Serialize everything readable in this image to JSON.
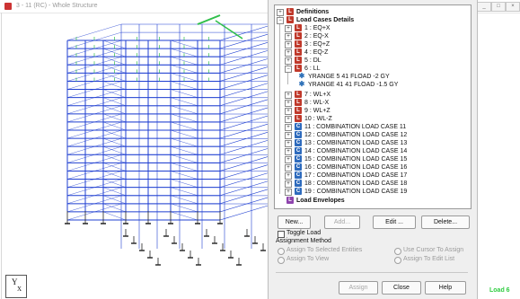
{
  "viewport": {
    "title": "3 - 11 (RC) - Whole Structure",
    "status_text": "Load 6",
    "axis_y_label": "Y",
    "axis_x_label": "X"
  },
  "dialog": {
    "tree": {
      "definitions_label": "Definitions",
      "load_cases_label": "Load Cases Details",
      "load_cases": [
        {
          "label": "1 : EQ+X"
        },
        {
          "label": "2 : EQ-X"
        },
        {
          "label": "3 : EQ+Z"
        },
        {
          "label": "4 : EQ-Z"
        },
        {
          "label": "5 : DL"
        },
        {
          "label": "6 : LL"
        }
      ],
      "ll_children": [
        {
          "label": "YRANGE 5 41 FLOAD -2 GY"
        },
        {
          "label": "YRANGE 41 41 FLOAD -1.5 GY"
        }
      ],
      "wind_cases": [
        {
          "label": "7 : WL+X"
        },
        {
          "label": "8 : WL-X"
        },
        {
          "label": "9 : WL+Z"
        },
        {
          "label": "10 : WL-Z"
        }
      ],
      "combinations": [
        {
          "label": "11 : COMBINATION LOAD CASE 11"
        },
        {
          "label": "12 : COMBINATION LOAD CASE 12"
        },
        {
          "label": "13 : COMBINATION LOAD CASE 13"
        },
        {
          "label": "14 : COMBINATION LOAD CASE 14"
        },
        {
          "label": "15 : COMBINATION LOAD CASE 15"
        },
        {
          "label": "16 : COMBINATION LOAD CASE 16"
        },
        {
          "label": "17 : COMBINATION LOAD CASE 17"
        },
        {
          "label": "18 : COMBINATION LOAD CASE 18"
        },
        {
          "label": "19 : COMBINATION LOAD CASE 19"
        }
      ],
      "envelopes_label": "Load Envelopes"
    },
    "buttons": {
      "new": "New...",
      "add": "Add...",
      "edit": "Edit ...",
      "delete": "Delete..."
    },
    "toggle_load_label": "Toggle Load",
    "assignment_method_label": "Assignment Method",
    "options": {
      "assign_selected": "Assign To Selected Entities",
      "use_cursor": "Use Cursor To Assign",
      "assign_view": "Assign To View",
      "assign_edit_list": "Assign To Edit List"
    },
    "footer": {
      "assign": "Assign",
      "close": "Close",
      "help": "Help"
    }
  },
  "colors": {
    "structure_members": "#1f3fd1",
    "loads": "#2fbf4a",
    "supports": "#222222",
    "status_green": "#2ecc40"
  }
}
